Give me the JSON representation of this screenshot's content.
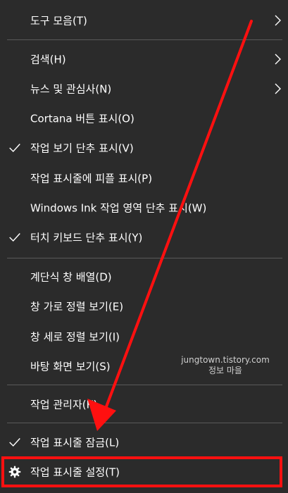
{
  "menu": {
    "items": [
      {
        "label": "도구 모음(T)",
        "checked": false,
        "submenu": true
      },
      {
        "label": "검색(H)",
        "checked": false,
        "submenu": true
      },
      {
        "label": "뉴스 및 관심사(N)",
        "checked": false,
        "submenu": true
      },
      {
        "label": "Cortana 버튼 표시(O)",
        "checked": false,
        "submenu": false
      },
      {
        "label": "작업 보기 단추 표시(V)",
        "checked": true,
        "submenu": false
      },
      {
        "label": "작업 표시줄에 피플 표시(P)",
        "checked": false,
        "submenu": false
      },
      {
        "label": "Windows Ink 작업 영역 단추 표시(W)",
        "checked": false,
        "submenu": false
      },
      {
        "label": "터치 키보드 단추 표시(Y)",
        "checked": true,
        "submenu": false
      },
      {
        "label": "계단식 창 배열(D)",
        "checked": false,
        "submenu": false
      },
      {
        "label": "창 가로 정렬 보기(E)",
        "checked": false,
        "submenu": false
      },
      {
        "label": "창 세로 정렬 보기(I)",
        "checked": false,
        "submenu": false
      },
      {
        "label": "바탕 화면 보기(S)",
        "checked": false,
        "submenu": false
      },
      {
        "label": "작업 관리자(K)",
        "checked": false,
        "submenu": false
      },
      {
        "label": "작업 표시줄 잠금(L)",
        "checked": true,
        "submenu": false
      },
      {
        "label": "작업 표시줄 설정(T)",
        "checked": false,
        "submenu": false,
        "icon": "gear-icon"
      }
    ]
  },
  "watermark": {
    "line1": "jungtown.tistory.com",
    "line2": "정보 마을"
  },
  "colors": {
    "menu_bg": "#2b2b2b",
    "text": "#ffffff",
    "separator": "#5a5a5a",
    "annotation_red": "#ff1010"
  }
}
